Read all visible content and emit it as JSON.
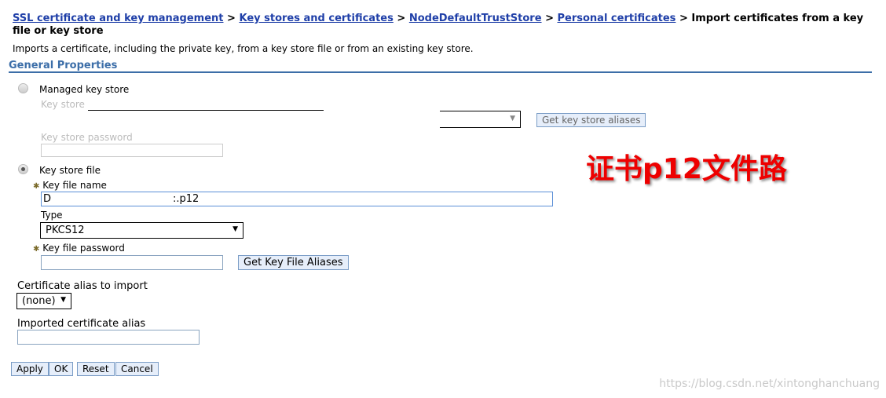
{
  "breadcrumb": {
    "links": [
      "SSL certificate and key management",
      "Key stores and certificates",
      "NodeDefaultTrustStore",
      "Personal certificates"
    ],
    "current": "Import certificates from a key file or key store",
    "separator": ">"
  },
  "description": "Imports a certificate, including the private key, from a key store file or from an existing key store.",
  "section_title": "General Properties",
  "managed": {
    "label": "Managed key store",
    "selected": false,
    "key_store_label": "Key store",
    "key_store_value": "",
    "get_aliases": "Get key store aliases",
    "password_label": "Key store password"
  },
  "keyfile": {
    "label": "Key store file",
    "selected": true,
    "name_label": "Key file name",
    "name_prefix": "D",
    "name_suffix": ":.p12",
    "type_label": "Type",
    "type_value": "PKCS12",
    "password_label": "Key file password",
    "get_aliases": "Get Key File Aliases"
  },
  "alias": {
    "label": "Certificate alias to import",
    "value": "(none)",
    "imported_label": "Imported certificate alias",
    "imported_value": ""
  },
  "buttons": {
    "apply": "Apply",
    "ok": "OK",
    "reset": "Reset",
    "cancel": "Cancel"
  },
  "annotation": "证书p12文件路",
  "watermark": "https://blog.csdn.net/xintonghanchuang",
  "colors": {
    "link": "#1f3fa8",
    "section": "#3c6ea8",
    "annotation": "#ee0000"
  }
}
